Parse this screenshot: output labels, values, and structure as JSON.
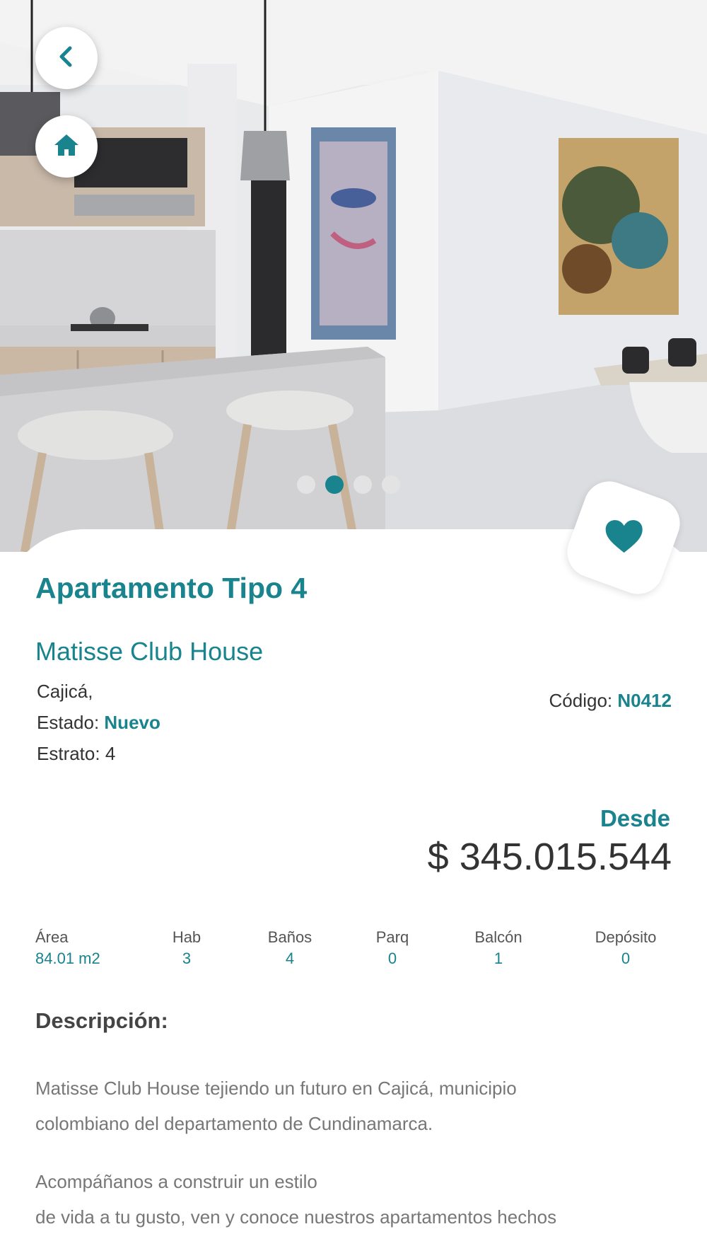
{
  "nav": {
    "back": "back",
    "home": "home"
  },
  "gallery": {
    "slides": 4,
    "active_index": 1
  },
  "listing": {
    "title": "Apartamento Tipo 4",
    "project": "Matisse Club House",
    "city": "Cajicá,",
    "estado_label": "Estado:",
    "estado_value": "Nuevo",
    "estrato": "Estrato: 4",
    "codigo_label": "Código:",
    "codigo_value": "N0412",
    "price_label": "Desde",
    "price": "$ 345.015.544"
  },
  "stats": [
    {
      "label": "Área",
      "value": "84.01 m2"
    },
    {
      "label": "Hab",
      "value": "3"
    },
    {
      "label": "Baños",
      "value": "4"
    },
    {
      "label": "Parq",
      "value": "0"
    },
    {
      "label": "Balcón",
      "value": "1"
    },
    {
      "label": "Depósito",
      "value": "0"
    }
  ],
  "description": {
    "heading": "Descripción:",
    "p1_line1": "Matisse Club House tejiendo un futuro en Cajicá, municipio",
    "p1_line2": "colombiano del departamento de Cundinamarca.",
    "p2_line1": "Acompáñanos a construir un estilo",
    "p2_line2": "de vida a tu gusto, ven y conoce nuestros apartamentos hechos"
  },
  "colors": {
    "accent": "#19838e",
    "text": "#333333",
    "muted": "#777777"
  },
  "icons": {
    "back": "chevron-left-icon",
    "home": "home-icon",
    "favorite": "heart-icon"
  }
}
